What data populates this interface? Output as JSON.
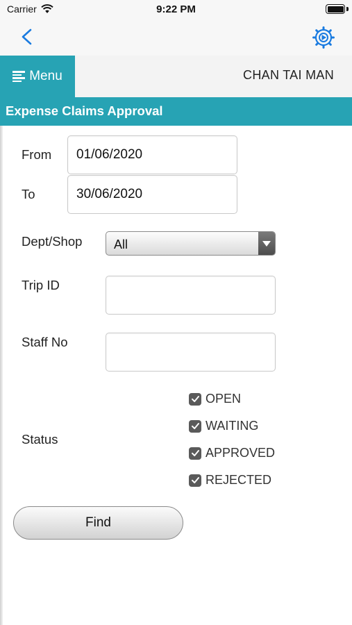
{
  "status_bar": {
    "carrier": "Carrier",
    "time": "9:22 PM",
    "battery": 1.0
  },
  "nav": {
    "back_icon": "chevron-left-icon",
    "settings_icon": "gear-icon",
    "accent_color": "#1a7be0"
  },
  "header": {
    "menu_label": "Menu",
    "user_name": "CHAN TAI MAN",
    "brand_color": "#27a3b4"
  },
  "page": {
    "title": "Expense Claims Approval"
  },
  "form": {
    "from_label": "From",
    "from_value": "01/06/2020",
    "to_label": "To",
    "to_value": "30/06/2020",
    "dept_label": "Dept/Shop",
    "dept_value": "All",
    "trip_label": "Trip ID",
    "trip_value": "",
    "staff_label": "Staff No",
    "staff_value": "",
    "status_label": "Status",
    "statuses": [
      {
        "label": "OPEN",
        "checked": true
      },
      {
        "label": "WAITING",
        "checked": true
      },
      {
        "label": "APPROVED",
        "checked": true
      },
      {
        "label": "REJECTED",
        "checked": true
      }
    ],
    "find_label": "Find"
  }
}
